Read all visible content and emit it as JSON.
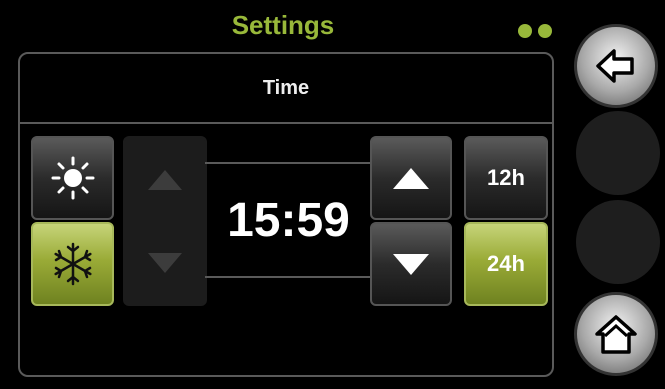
{
  "header": {
    "title": "Settings"
  },
  "panel": {
    "title": "Time"
  },
  "mode_buttons": [
    {
      "icon": "sun-icon",
      "active": false
    },
    {
      "icon": "snowflake-icon",
      "active": true
    }
  ],
  "clock": {
    "time": "15:59"
  },
  "format_buttons": {
    "h12_label": "12h",
    "h24_label": "24h",
    "selected": "24h"
  },
  "side_buttons": {
    "back_icon": "back-arrow-icon",
    "home_icon": "home-icon"
  },
  "colors": {
    "accent": "#98b83a",
    "active_button": "#9aab37",
    "background": "#000000"
  }
}
